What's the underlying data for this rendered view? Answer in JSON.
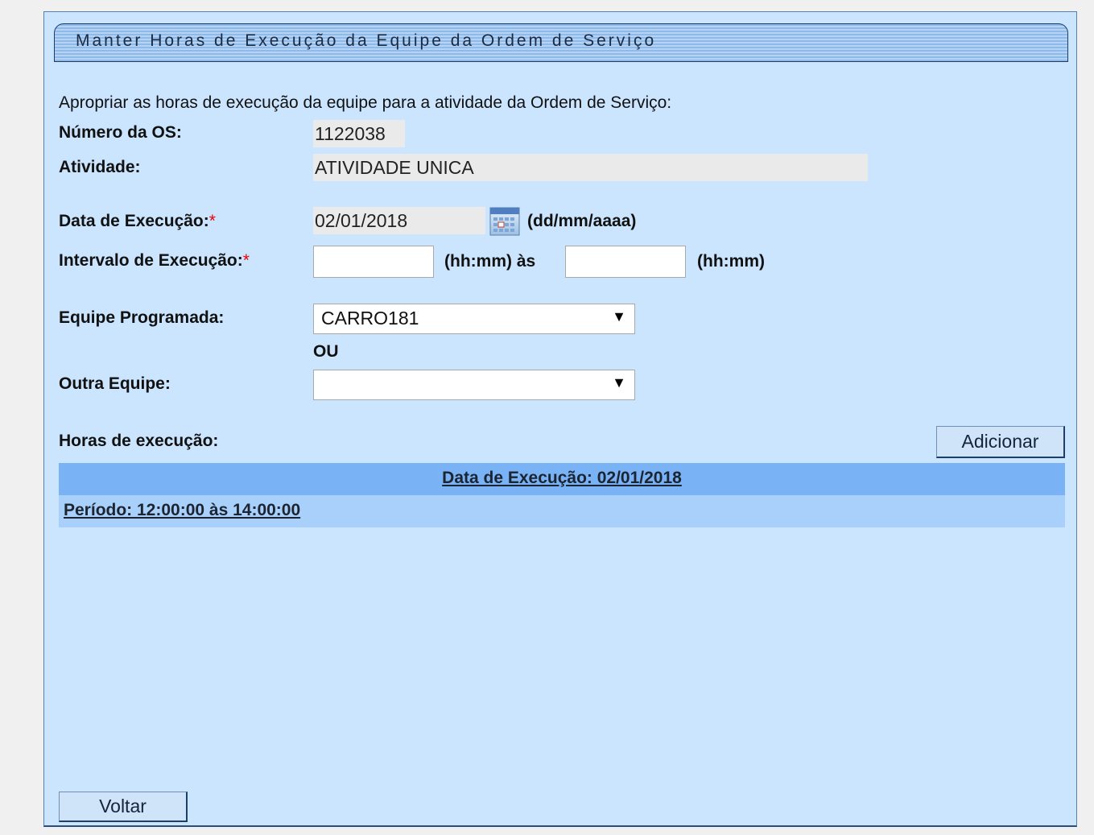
{
  "title": "Manter Horas de Execução da Equipe da Ordem de Serviço",
  "intro": "Apropriar as horas de execução da equipe para a atividade da Ordem de Serviço:",
  "os": {
    "label": "Número da OS:",
    "value": "1122038"
  },
  "atividade": {
    "label": "Atividade:",
    "value": "ATIVIDADE UNICA"
  },
  "data_execucao": {
    "label": "Data de Execução:",
    "required_mark": "*",
    "value": "02/01/2018",
    "format_hint": "(dd/mm/aaaa)",
    "icon": "calendar-icon"
  },
  "intervalo": {
    "label": "Intervalo de Execução:",
    "required_mark": "*",
    "start_value": "",
    "hint_start": "(hh:mm) às",
    "end_value": "",
    "hint_end": "(hh:mm)"
  },
  "equipe_programada": {
    "label": "Equipe Programada:",
    "selected": "CARRO181"
  },
  "ou_label": "OU",
  "outra_equipe": {
    "label": "Outra Equipe:",
    "selected": ""
  },
  "horas": {
    "label": "Horas de execução:",
    "add_button": "Adicionar",
    "group_header": "Data de Execução: 02/01/2018",
    "rows": [
      {
        "text": "Período: 12:00:00 às 14:00:00"
      }
    ]
  },
  "back_button": "Voltar",
  "colors": {
    "panel_bg": "#cbe5fe",
    "grid_header": "#79b3f5",
    "grid_row": "#a8d0fb",
    "required": "#e00000"
  }
}
